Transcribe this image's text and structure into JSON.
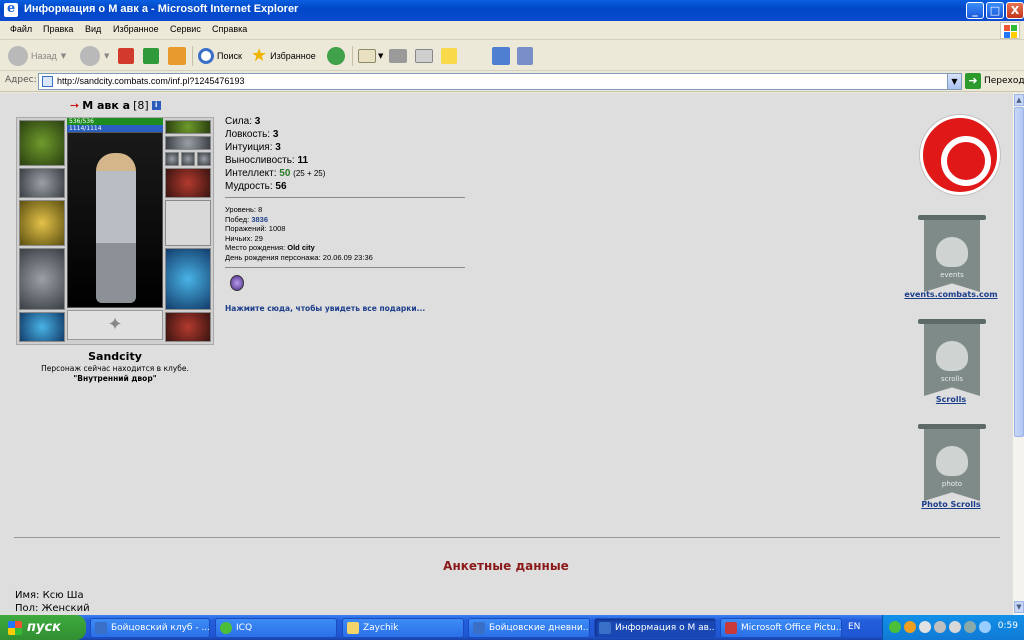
{
  "window": {
    "title": "Информация о М авк а - Microsoft Internet Explorer",
    "buttons": {
      "minimize": "_",
      "maximize": "□",
      "close": "X"
    }
  },
  "menu": [
    "Файл",
    "Правка",
    "Вид",
    "Избранное",
    "Сервис",
    "Справка"
  ],
  "toolbar": {
    "back": "Назад",
    "search": "Поиск",
    "favorites": "Избранное"
  },
  "address": {
    "label": "Адрес:",
    "url": "http://sandcity.combats.com/inf.pl?1245476193",
    "go": "Переход"
  },
  "character": {
    "name": "М авк а",
    "level": "[8]",
    "hp": "536/536",
    "mana": "1114/1114",
    "city": "Sandcity",
    "club_note": "Персонаж сейчас находится в клубе.",
    "room": "\"Внутренний двор\""
  },
  "stats": [
    {
      "label": "Сила:",
      "value": "3",
      "bonus": ""
    },
    {
      "label": "Ловкость:",
      "value": "3",
      "bonus": ""
    },
    {
      "label": "Интуиция:",
      "value": "3",
      "bonus": ""
    },
    {
      "label": "Выносливость:",
      "value": "11",
      "bonus": ""
    },
    {
      "label": "Интеллект:",
      "value": "50",
      "bonus": "(25 + 25)"
    },
    {
      "label": "Мудрость:",
      "value": "56",
      "bonus": ""
    }
  ],
  "details": {
    "level": {
      "label": "Уровень:",
      "value": "8"
    },
    "wins": {
      "label": "Побед:",
      "value": "3836"
    },
    "losses": {
      "label": "Поражений:",
      "value": "1008"
    },
    "draws": {
      "label": "Ничьих:",
      "value": "29"
    },
    "birthplace": {
      "label": "Место рождения:",
      "value": "Old city"
    },
    "birthday": {
      "label": "День рождения персонажа:",
      "value": "20.06.09 23:36"
    }
  },
  "gifts_link": "Нажмите сюда, чтобы увидеть все подарки...",
  "banners": [
    {
      "text": "events",
      "caption": "events.combats.com"
    },
    {
      "text": "scrolls",
      "caption": "Scrolls"
    },
    {
      "text": "photo",
      "caption": "Photo Scrolls"
    }
  ],
  "profile": {
    "title": "Анкетные данные",
    "name_label": "Имя:",
    "name_value": "Ксю Ша",
    "sex_label": "Пол:",
    "sex_value": "Женский"
  },
  "taskbar": {
    "start": "пуск",
    "tasks": [
      "Бойцовский клуб - ...",
      "ICQ",
      "Zaychik",
      "Бойцовские дневни...",
      "Информация о М ав...",
      "Microsoft Office Pictu..."
    ],
    "lang": "EN",
    "clock": "0:59"
  },
  "colors": {
    "accent": "#2a7a2a",
    "link": "#1c3e8a",
    "section_title": "#8b1a1a",
    "logo": "#e01818"
  }
}
